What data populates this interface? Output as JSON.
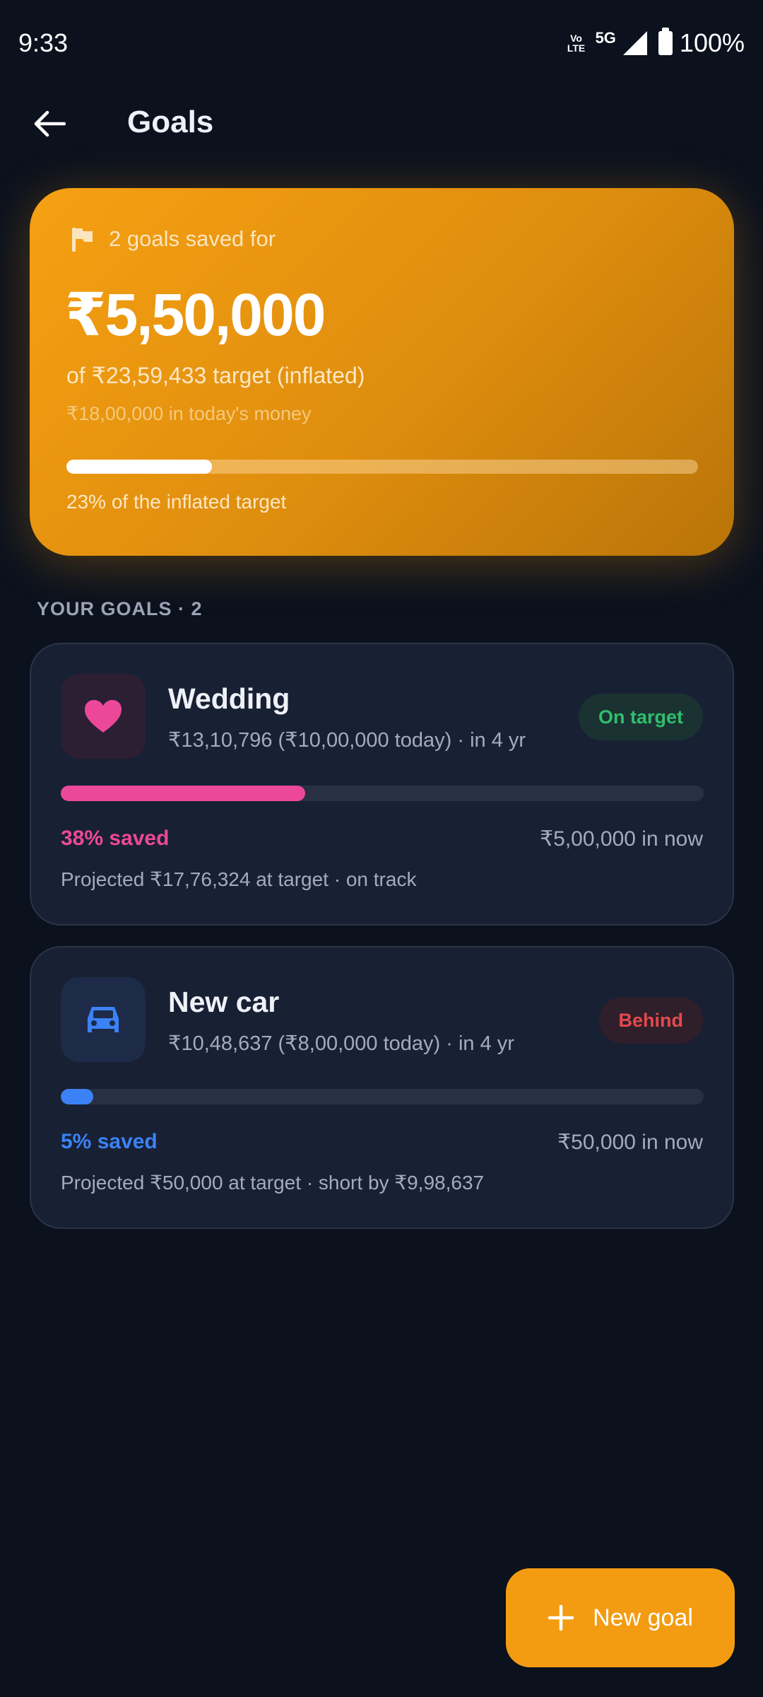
{
  "status_bar": {
    "time": "9:33",
    "volte": "Vo\nLTE",
    "network": "5G",
    "battery": "100%"
  },
  "header": {
    "back_icon": "arrow-left-icon",
    "title": "Goals"
  },
  "summary": {
    "icon": "flag-icon",
    "label": "2 goals saved for",
    "amount": "₹5,50,000",
    "of_target": "of ₹23,59,433 target (inflated)",
    "today_money": "₹18,00,000 in today's money",
    "progress": 0.23,
    "progress_label": "23% of the inflated target"
  },
  "section_label": "YOUR GOALS · 2",
  "goals": [
    {
      "icon": "heart-icon",
      "title": "Wedding",
      "subtitle": "₹13,10,796 (₹10,00,000 today) · in 4 yr",
      "badge": "On target",
      "badge_color": "#2fbf6b",
      "badge_bg": "#1a3332",
      "progress": 0.38,
      "accent_color": "#ec4899",
      "saved_label": "38% saved",
      "in_now": "₹5,00,000 in now",
      "projection": "Projected ₹17,76,324 at target · on track"
    },
    {
      "icon": "car-icon",
      "title": "New car",
      "subtitle": "₹10,48,637 (₹8,00,000 today) · in 4 yr",
      "badge": "Behind",
      "badge_color": "#e5484d",
      "badge_bg": "#2f1f2b",
      "progress": 0.05,
      "accent_color": "#3b82f6",
      "saved_label": "5% saved",
      "in_now": "₹50,000 in now",
      "projection": "Projected ₹50,000 at target · short by ₹9,98,637"
    }
  ],
  "fab": {
    "icon": "plus-icon",
    "label": "New goal"
  },
  "colors": {
    "background": "#0b111d",
    "summary_accent": "#f39c12",
    "card_bg": "#182033"
  }
}
